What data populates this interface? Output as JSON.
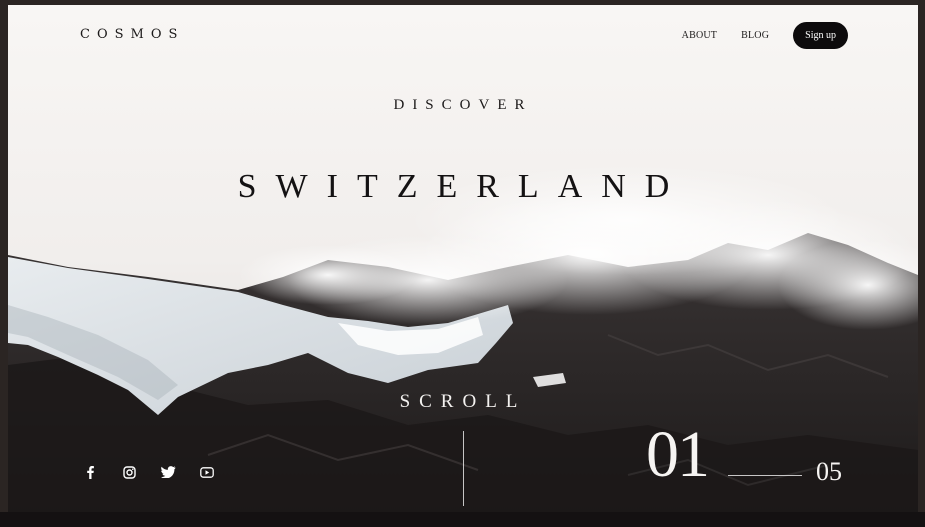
{
  "brand": "COSMOS",
  "nav": {
    "about_label": "ABOUT",
    "blog_label": "BLOG",
    "signup_label": "Sign up"
  },
  "hero": {
    "kicker": "DISCOVER",
    "title": "SWITZERLAND",
    "scroll_label": "SCROLL"
  },
  "socials": [
    {
      "icon": "facebook-icon"
    },
    {
      "icon": "instagram-icon"
    },
    {
      "icon": "twitter-icon"
    },
    {
      "icon": "youtube-icon"
    }
  ],
  "slider": {
    "current": "01",
    "total": "05"
  },
  "colors": {
    "sky": "#f6f3f0",
    "rock": "#2c2827",
    "button": "#0d0b0c",
    "frame": "#2b2523"
  }
}
